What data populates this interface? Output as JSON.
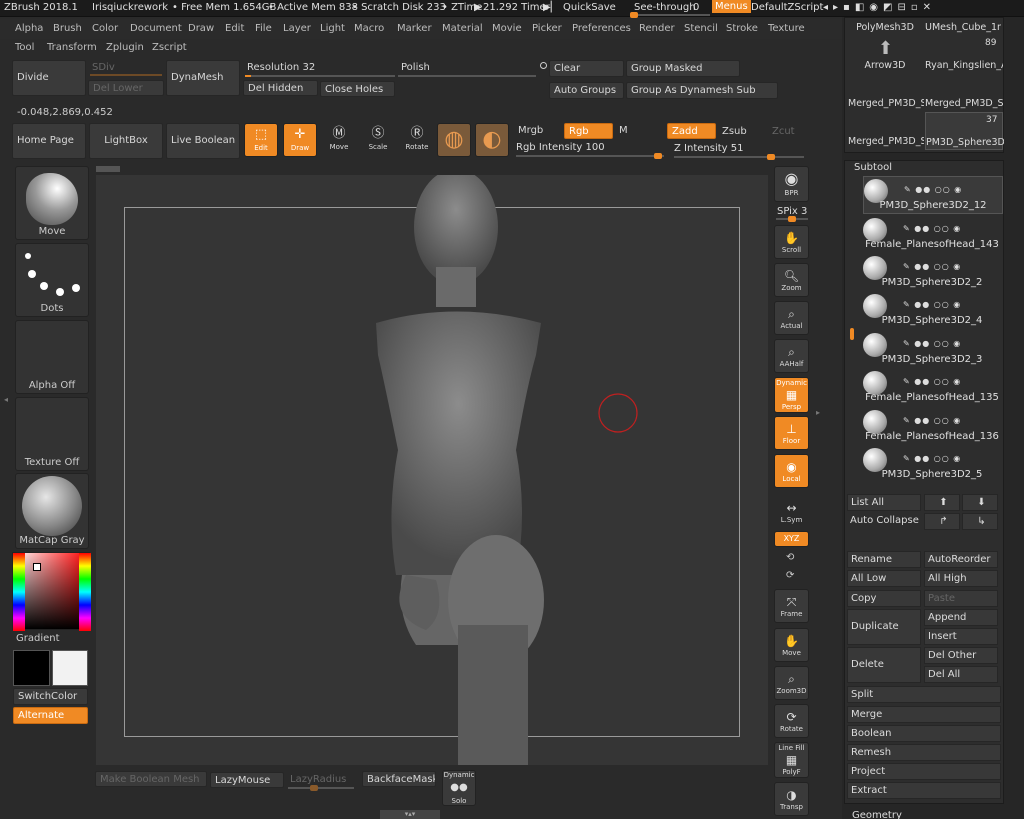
{
  "titlebar": {
    "app": "ZBrush 2018.1",
    "doc": "Irisqiuckrework",
    "free_mem": "• Free Mem 1.654GB",
    "active_mem": "• Active Mem 838",
    "scratch": "• Scratch Disk 233",
    "ztime": "• ZTime",
    "timer": "21.292 Timer",
    "quicksave": "QuickSave",
    "see_through": "See-through",
    "see_through_val": "0",
    "menus": "Menus",
    "script": "DefaultZScript"
  },
  "menu": [
    "Alpha",
    "Brush",
    "Color",
    "Document",
    "Draw",
    "Edit",
    "File",
    "Layer",
    "Light",
    "Macro",
    "Marker",
    "Material",
    "Movie",
    "Picker",
    "Preferences",
    "Render",
    "Stencil",
    "Stroke",
    "Texture"
  ],
  "menu2": [
    "Tool",
    "Transform",
    "Zplugin",
    "Zscript"
  ],
  "geometry": {
    "divide": "Divide",
    "sdiv": "SDiv",
    "del_lower": "Del Lower",
    "dynamesh": "DynaMesh",
    "resolution": "Resolution",
    "resolution_val": "32",
    "polish": "Polish",
    "del_hidden": "Del Hidden",
    "close_holes": "Close Holes",
    "clear": "Clear",
    "group_masked": "Group Masked",
    "auto_groups": "Auto Groups",
    "group_as_dynamesh": "Group As Dynamesh Sub",
    "coords": "-0.048,2.869,0.452"
  },
  "shelf": {
    "home": "Home Page",
    "lightbox": "LightBox",
    "live_boolean": "Live Boolean",
    "edit": "Edit",
    "draw": "Draw",
    "move": "Move",
    "scale": "Scale",
    "rotate": "Rotate",
    "mrgb": "Mrgb",
    "rgb": "Rgb",
    "m": "M",
    "zadd": "Zadd",
    "zsub": "Zsub",
    "zcut": "Zcut",
    "rgb_intensity": "Rgb Intensity",
    "rgb_intensity_val": "100",
    "z_intensity": "Z Intensity",
    "z_intensity_val": "51"
  },
  "left": {
    "brush": "Move",
    "stroke": "Dots",
    "alpha": "Alpha Off",
    "texture": "Texture Off",
    "material": "MatCap Gray",
    "gradient": "Gradient",
    "switch_color": "SwitchColor",
    "alternate": "Alternate",
    "main_color": "#000000",
    "secondary_color": "#f2f2f2"
  },
  "bottom": {
    "make_boolean": "Make Boolean Mesh",
    "lazymouse": "LazyMouse",
    "lazyradius": "LazyRadius",
    "backfacemask": "BackfaceMask",
    "dynamic": "Dynamic",
    "solo": "Solo"
  },
  "right_tools": {
    "bpr": "BPR",
    "spix": "SPix",
    "spix_val": "3",
    "scroll": "Scroll",
    "zoom": "Zoom",
    "actual": "Actual",
    "aahalf": "AAHalf",
    "dynamic": "Dynamic",
    "persp": "Persp",
    "floor": "Floor",
    "local": "Local",
    "lsym": "L.Sym",
    "xyz": "XYZ",
    "frame": "Frame",
    "move": "Move",
    "zoom3d": "Zoom3D",
    "rotate": "Rotate",
    "line_fill": "Line Fill",
    "polyf": "PolyF",
    "transp": "Transp"
  },
  "tool_thumbs": [
    {
      "name": "PolyMesh3D"
    },
    {
      "name": "UMesh_Cube_1n"
    },
    {
      "name": "Arrow3D"
    },
    {
      "name": "Ryan_Kingslien_A",
      "count": "89"
    },
    {
      "name": "Merged_PM3D_S"
    },
    {
      "name": "Merged_PM3D_S"
    },
    {
      "name": "Merged_PM3D_S"
    },
    {
      "name": "PM3D_Sphere3D",
      "count": "37"
    }
  ],
  "subtool": {
    "title": "Subtool",
    "items": [
      "PM3D_Sphere3D2_12",
      "Female_PlanesofHead_143",
      "PM3D_Sphere3D2_2",
      "PM3D_Sphere3D2_4",
      "PM3D_Sphere3D2_3",
      "Female_PlanesofHead_135",
      "Female_PlanesofHead_136",
      "PM3D_Sphere3D2_5"
    ],
    "list_all": "List All",
    "auto_collapse": "Auto Collapse",
    "rename": "Rename",
    "autoreorder": "AutoReorder",
    "all_low": "All Low",
    "all_high": "All High",
    "copy": "Copy",
    "paste": "Paste",
    "append": "Append",
    "duplicate": "Duplicate",
    "insert": "Insert",
    "delete": "Delete",
    "del_other": "Del Other",
    "del_all": "Del All",
    "split": "Split",
    "merge": "Merge",
    "boolean": "Boolean",
    "remesh": "Remesh",
    "project": "Project",
    "extract": "Extract",
    "geometry": "Geometry"
  },
  "colors": {
    "accent": "#f08a24",
    "panel": "#2b2b2b",
    "canvas": "#353535"
  }
}
